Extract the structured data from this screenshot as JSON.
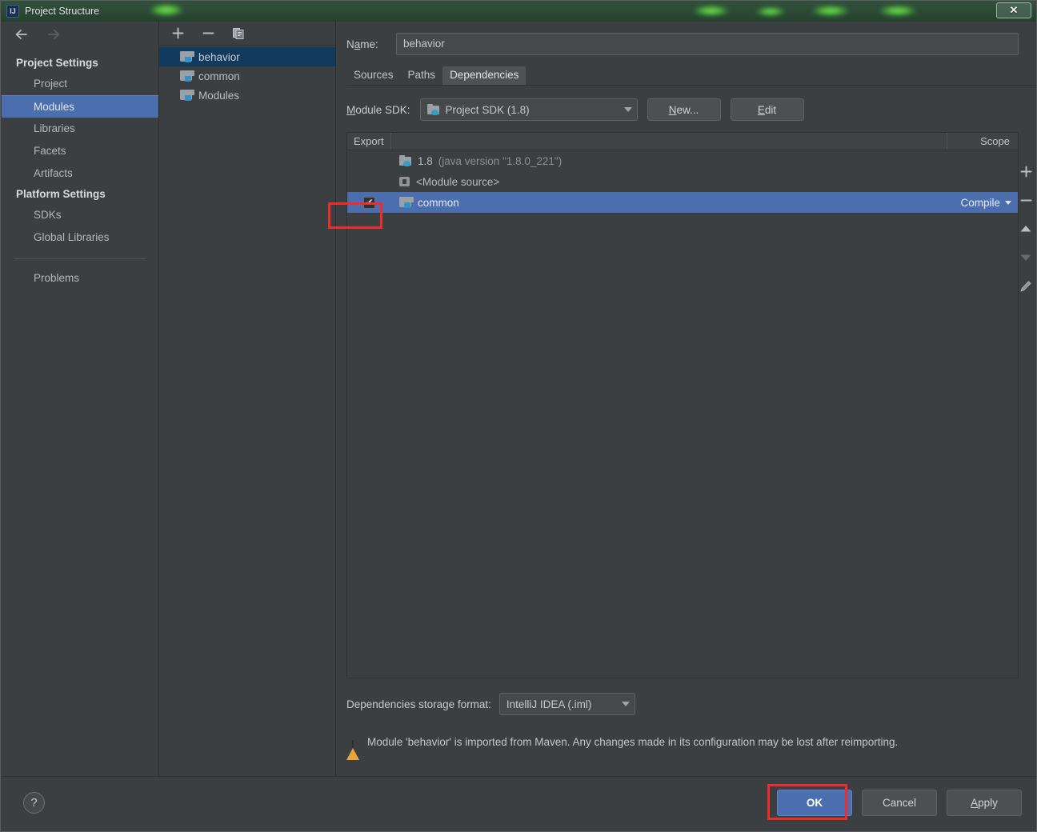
{
  "window": {
    "title": "Project Structure",
    "app_icon": "intellij-idea-icon",
    "close_label": "✕"
  },
  "sidebar": {
    "back_icon": "back-arrow-icon",
    "forward_icon": "forward-arrow-icon",
    "groups": [
      {
        "label": "Project Settings",
        "items": [
          {
            "label": "Project",
            "selected": false
          },
          {
            "label": "Modules",
            "selected": true
          },
          {
            "label": "Libraries",
            "selected": false
          },
          {
            "label": "Facets",
            "selected": false
          },
          {
            "label": "Artifacts",
            "selected": false
          }
        ]
      },
      {
        "label": "Platform Settings",
        "items": [
          {
            "label": "SDKs",
            "selected": false
          },
          {
            "label": "Global Libraries",
            "selected": false
          }
        ]
      }
    ],
    "problems_label": "Problems"
  },
  "module_tree": {
    "toolbar": {
      "add_icon": "plus-icon",
      "remove_icon": "minus-icon",
      "copy_icon": "copy-icon"
    },
    "items": [
      {
        "label": "behavior",
        "selected": true
      },
      {
        "label": "common",
        "selected": false
      },
      {
        "label": "Modules",
        "selected": false
      }
    ]
  },
  "main": {
    "name_label": "Name:",
    "name_label_prefix": "N",
    "name_label_mnemonic": "a",
    "name_label_suffix": "me:",
    "name_value": "behavior",
    "tabs": [
      {
        "label": "Sources",
        "active": false
      },
      {
        "label": "Paths",
        "active": false
      },
      {
        "label": "Dependencies",
        "active": true
      }
    ],
    "sdk_label_prefix": "",
    "sdk_label_mnemonic": "M",
    "sdk_label_suffix": "odule SDK:",
    "sdk_value": "Project SDK (1.8)",
    "sdk_icon": "sdk-folder-icon",
    "new_button_mnemonic": "N",
    "new_button_suffix": "ew...",
    "edit_button_prefix": "",
    "edit_button_mnemonic": "E",
    "edit_button_suffix": "dit",
    "table": {
      "headers": {
        "export": "Export",
        "scope": "Scope"
      },
      "rows": [
        {
          "export_checked": false,
          "show_checkbox": false,
          "icon": "sdk-folder-icon",
          "label": "1.8",
          "sublabel": "(java version \"1.8.0_221\")",
          "scope": "",
          "selected": false
        },
        {
          "export_checked": false,
          "show_checkbox": false,
          "icon": "module-source-icon",
          "label": "<Module source>",
          "sublabel": "",
          "scope": "",
          "selected": false
        },
        {
          "export_checked": true,
          "show_checkbox": true,
          "icon": "module-folder-icon",
          "label": "common",
          "sublabel": "",
          "scope": "Compile",
          "selected": true
        }
      ]
    },
    "right_toolbar": [
      {
        "icon": "plus-icon",
        "enabled": true
      },
      {
        "icon": "minus-icon",
        "enabled": true
      },
      {
        "icon": "arrow-up-icon",
        "enabled": true
      },
      {
        "icon": "arrow-down-icon",
        "enabled": false
      },
      {
        "icon": "edit-pencil-icon",
        "enabled": true
      }
    ],
    "storage_label": "Dependencies storage format:",
    "storage_value": "IntelliJ IDEA (.iml)",
    "warning_icon": "warning-triangle-icon",
    "warning_text": "Module 'behavior' is imported from Maven. Any changes made in its configuration may be lost after reimporting."
  },
  "footer": {
    "help_label": "?",
    "help_icon": "help-icon",
    "ok_label": "OK",
    "cancel_label": "Cancel",
    "apply_mnemonic": "A",
    "apply_suffix": "pply"
  },
  "colors": {
    "accent_blue": "#4b6eaf",
    "tree_selection": "#113a5c",
    "background": "#3c3f41",
    "warning_orange": "#e8a33d",
    "annotation_red": "#f02b2b",
    "titlebar_green": "#2d4a36"
  }
}
